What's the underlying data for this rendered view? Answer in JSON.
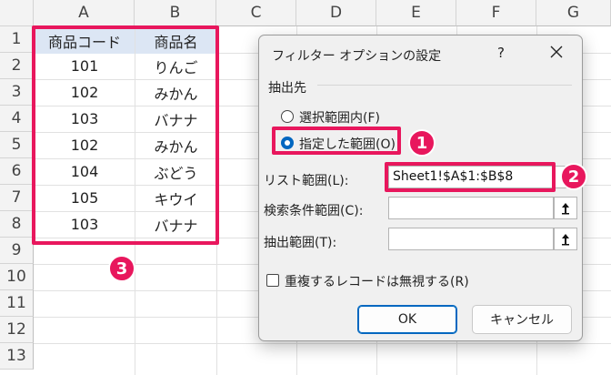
{
  "columns": [
    "A",
    "B",
    "C",
    "D",
    "E",
    "F",
    "G"
  ],
  "rows": [
    "1",
    "2",
    "3",
    "4",
    "5",
    "6",
    "7",
    "8",
    "9",
    "10",
    "11",
    "12",
    "13"
  ],
  "table": {
    "headers": [
      "商品コード",
      "商品名"
    ],
    "records": [
      [
        "101",
        "りんご"
      ],
      [
        "102",
        "みかん"
      ],
      [
        "103",
        "バナナ"
      ],
      [
        "102",
        "みかん"
      ],
      [
        "104",
        "ぶどう"
      ],
      [
        "105",
        "キウイ"
      ],
      [
        "103",
        "バナナ"
      ]
    ]
  },
  "badges": [
    "1",
    "2",
    "3"
  ],
  "colors": {
    "highlight": "#e8175d",
    "header_fill": "#dce6f4",
    "accent": "#0067c0"
  },
  "dialog": {
    "title": "フィルター オプションの設定",
    "help": "?",
    "section_label": "抽出先",
    "radio_select_range": "選択範囲内(F)",
    "radio_specified_range": "指定した範囲(O)",
    "list_range_label": "リスト範囲(L):",
    "list_range_value": "Sheet1!$A$1:$B$8",
    "criteria_range_label": "検索条件範囲(C):",
    "criteria_range_value": "",
    "extract_range_label": "抽出範囲(T):",
    "extract_range_value": "",
    "unique_records_label": "重複するレコードは無視する(R)",
    "ok_label": "OK",
    "cancel_label": "キャンセル"
  }
}
